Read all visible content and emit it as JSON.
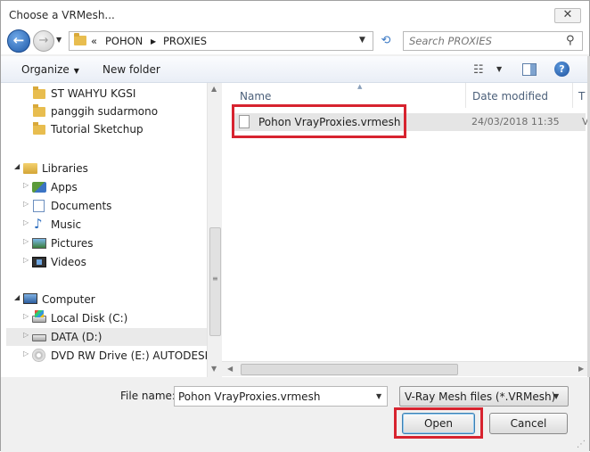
{
  "window": {
    "title": "Choose a VRMesh...",
    "close_glyph": "✕"
  },
  "nav_controls": {
    "back_glyph": "←",
    "forward_glyph": "→",
    "history_glyph": "▼",
    "refresh_glyph": "⟲"
  },
  "address": {
    "overflow": "«",
    "crumbs": [
      "POHON",
      "PROXIES"
    ],
    "separator": "▶",
    "dropdown_glyph": "▼"
  },
  "search": {
    "placeholder": "Search PROXIES",
    "icon_glyph": "⚲"
  },
  "toolbar": {
    "organize_label": "Organize",
    "new_folder_label": "New folder",
    "caret": "▼",
    "view_glyph": "☷",
    "help_glyph": "?"
  },
  "nav_pane": {
    "items": [
      {
        "label": "ST WAHYU KGSI",
        "icon": "folder-icon"
      },
      {
        "label": "panggih sudarmono",
        "icon": "folder-icon"
      },
      {
        "label": "Tutorial Sketchup",
        "icon": "folder-icon"
      },
      {
        "label": "Libraries",
        "icon": "libraries-icon"
      },
      {
        "label": "Apps",
        "icon": "apps-icon"
      },
      {
        "label": "Documents",
        "icon": "documents-icon"
      },
      {
        "label": "Music",
        "icon": "music-icon"
      },
      {
        "label": "Pictures",
        "icon": "pictures-icon"
      },
      {
        "label": "Videos",
        "icon": "videos-icon"
      },
      {
        "label": "Computer",
        "icon": "computer-icon"
      },
      {
        "label": "Local Disk (C:)",
        "icon": "drive-icon"
      },
      {
        "label": "DATA (D:)",
        "icon": "drive-icon"
      },
      {
        "label": "DVD RW Drive (E:) AUTODESK.SIM",
        "icon": "dvd-icon"
      }
    ],
    "selected": "DATA (D:)",
    "expanded_glyph": "◢",
    "collapsed_glyph": "▷",
    "music_glyph": "♪",
    "scroll_up_glyph": "▲",
    "scroll_down_glyph": "▼",
    "grip_glyph": "≡"
  },
  "file_list": {
    "columns": [
      "Name",
      "Date modified",
      "T"
    ],
    "sort_glyph": "▲",
    "files": [
      {
        "name": "Pohon VrayProxies.vrmesh",
        "date_modified": "24/03/2018 11:35",
        "type_truncated": "V"
      }
    ],
    "scroll_left_glyph": "◀",
    "scroll_right_glyph": "▶"
  },
  "bottom": {
    "file_name_label": "File name:",
    "file_name_value": "Pohon VrayProxies.vrmesh",
    "file_type_selected": "V-Ray Mesh files (*.VRMesh)",
    "dropdown_glyph": "▼",
    "open_label": "Open",
    "cancel_label": "Cancel",
    "resize_glyph": "⋰"
  },
  "colors": {
    "highlight_box": "#d7232f",
    "selection": "#e5e5e5",
    "accent_blue": "#3c7fb1"
  }
}
